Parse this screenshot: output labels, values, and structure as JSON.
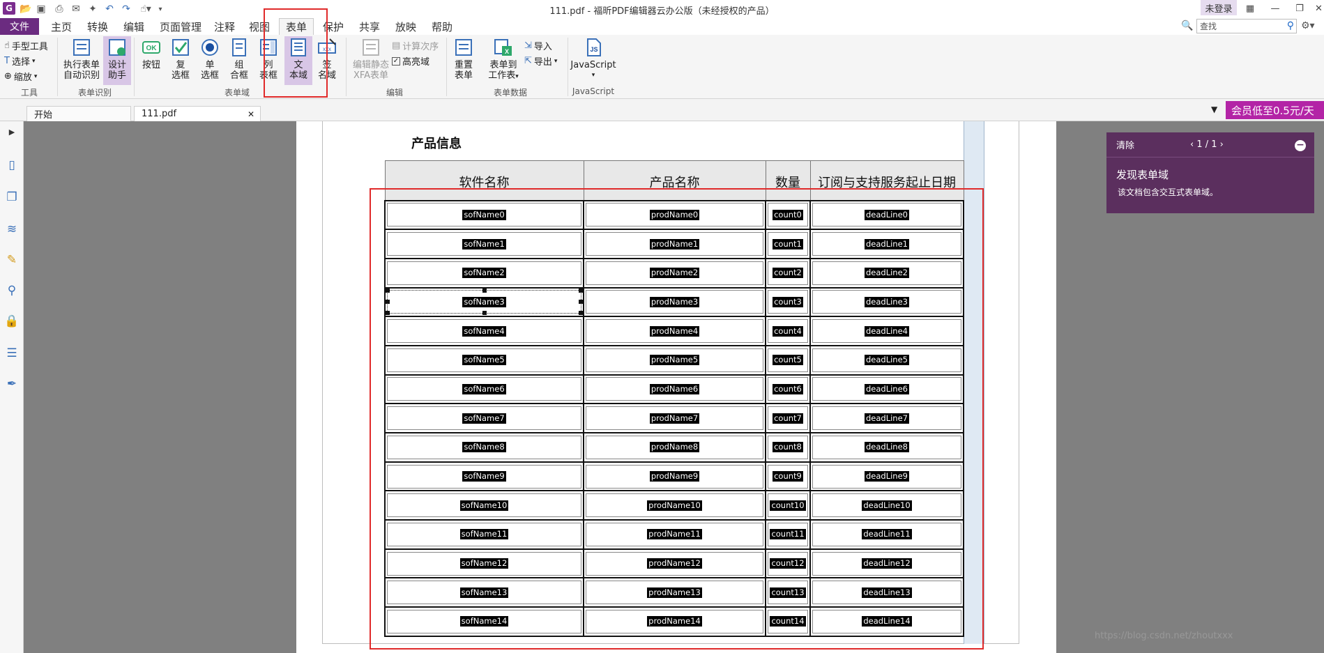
{
  "window": {
    "title": "111.pdf - 福昕PDF编辑器云办公版（未经授权的产品）",
    "login": "未登录"
  },
  "menu": {
    "file": "文件",
    "tabs": [
      "主页",
      "转换",
      "编辑",
      "页面管理",
      "注释",
      "视图",
      "表单",
      "保护",
      "共享",
      "放映",
      "帮助"
    ],
    "active_tab": "表单",
    "search_placeholder": "查找"
  },
  "ribbon": {
    "tools": {
      "hand": "手型工具",
      "select": "选择",
      "zoom": "缩放",
      "group": "工具"
    },
    "recognize": {
      "auto_1": "执行表单",
      "auto_2": "自动识别",
      "design_1": "设计",
      "design_2": "助手",
      "group": "表单识别"
    },
    "fields": {
      "button": "按钮",
      "checkbox_1": "复",
      "checkbox_2": "选框",
      "radio_1": "单",
      "radio_2": "选框",
      "combo_1": "组",
      "combo_2": "合框",
      "list_1": "列",
      "list_2": "表框",
      "text_1": "文",
      "text_2": "本域",
      "sign_1": "签",
      "sign_2": "名域",
      "group": "表单域"
    },
    "edit": {
      "xfa_1": "编辑静态",
      "xfa_2": "XFA表单",
      "calc_order": "计算次序",
      "highlight": "高亮域",
      "group": "编辑"
    },
    "data": {
      "reset_1": "重置",
      "reset_2": "表单",
      "to_sheet_1": "表单到",
      "to_sheet_2": "工作表",
      "import": "导入",
      "export": "导出",
      "group": "表单数据"
    },
    "js": {
      "label": "JavaScript",
      "group": "JavaScript"
    }
  },
  "doc_tabs": {
    "start": "开始",
    "file": "111.pdf",
    "promo": "会员低至0.5元/天"
  },
  "document": {
    "section_title": "产品信息",
    "headers": [
      "软件名称",
      "产品名称",
      "数量",
      "订阅与支持服务起止日期"
    ],
    "rows": [
      [
        "sofName0",
        "prodName0",
        "count0",
        "deadLine0"
      ],
      [
        "sofName1",
        "prodName1",
        "count1",
        "deadLine1"
      ],
      [
        "sofName2",
        "prodName2",
        "count2",
        "deadLine2"
      ],
      [
        "sofName3",
        "prodName3",
        "count3",
        "deadLine3"
      ],
      [
        "sofName4",
        "prodName4",
        "count4",
        "deadLine4"
      ],
      [
        "sofName5",
        "prodName5",
        "count5",
        "deadLine5"
      ],
      [
        "sofName6",
        "prodName6",
        "count6",
        "deadLine6"
      ],
      [
        "sofName7",
        "prodName7",
        "count7",
        "deadLine7"
      ],
      [
        "sofName8",
        "prodName8",
        "count8",
        "deadLine8"
      ],
      [
        "sofName9",
        "prodName9",
        "count9",
        "deadLine9"
      ],
      [
        "sofName10",
        "prodName10",
        "count10",
        "deadLine10"
      ],
      [
        "sofName11",
        "prodName11",
        "count11",
        "deadLine11"
      ],
      [
        "sofName12",
        "prodName12",
        "count12",
        "deadLine12"
      ],
      [
        "sofName13",
        "prodName13",
        "count13",
        "deadLine13"
      ],
      [
        "sofName14",
        "prodName14",
        "count14",
        "deadLine14"
      ]
    ],
    "selected_field": "sofName3"
  },
  "panel": {
    "clear": "清除",
    "nav": "1 / 1",
    "title": "发现表单域",
    "desc": "该文档包含交互式表单域。"
  },
  "watermark": "https://blog.csdn.net/zhoutxxx",
  "colors": {
    "brand_purple": "#6b2b80",
    "highlight": "#e02a2a",
    "promo": "#b324a6"
  }
}
